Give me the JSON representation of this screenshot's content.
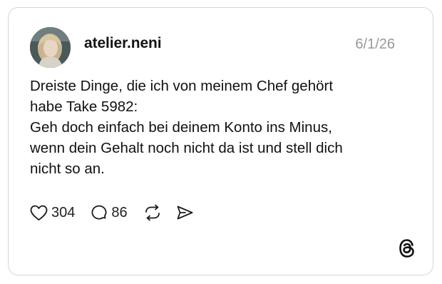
{
  "post": {
    "username": "atelier.neni",
    "date": "6/1/26",
    "text_lines": [
      "Dreiste Dinge, die ich von meinem Chef gehört",
      "habe Take 5982:",
      "Geh doch einfach bei deinem Konto ins Minus,",
      "wenn dein Gehalt noch nicht da ist und stell dich",
      "nicht so an."
    ],
    "likes": "304",
    "replies": "86"
  },
  "icons": {
    "like": "heart-icon",
    "reply": "speech-bubble-icon",
    "repost": "repost-icon",
    "share": "send-icon",
    "brand": "threads-logo-icon"
  }
}
